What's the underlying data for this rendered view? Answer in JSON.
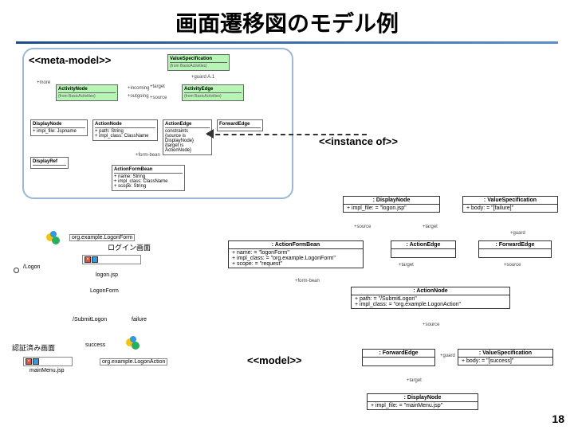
{
  "title": "画面遷移図のモデル例",
  "slide_number": "18",
  "labels": {
    "meta_model": "<<meta-model>>",
    "instance_of": "<<instance of>>",
    "model": "<<model>>"
  },
  "meta": {
    "value_spec": {
      "name": "ValueSpecification",
      "sub": "(from BasicActivities)"
    },
    "activity_node": {
      "name": "ActivityNode",
      "sub": "(from BasicActivities)"
    },
    "activity_edge": {
      "name": "ActivityEdge",
      "sub": "(from BasicActivities)"
    },
    "display_node": {
      "name": "DisplayNode",
      "attr": "+ impl_file: Jspname"
    },
    "action_node": {
      "name": "ActionNode",
      "attr": "+ path: String\n+ impl_class: ClassName"
    },
    "forward_edge": {
      "name": "ForwardEdge"
    },
    "action_edge": {
      "name": "ActionEdge",
      "constraint": "constraints\n{source is DisplayNode}\n{target is ActionNode}"
    },
    "action_form_bean": {
      "name": "ActionFormBean",
      "attr": "+ name: String\n+ impl_class: ClassName\n+ scope: String"
    },
    "display_ref": {
      "name": "DisplayRef"
    },
    "more": "+more"
  },
  "model_diagram": {
    "login_title": "ログイン画面",
    "auth_title": "認証済み画面",
    "logon": "/Logon",
    "logon_jsp": "logon.jsp",
    "logon_form": "LogonForm",
    "submit_logon": "/SubmitLogon",
    "main_menu": "mainMenu.jsp",
    "failure": "failure",
    "success": "success",
    "logon_form_pkg": "org.example.LogonForm",
    "logon_action_pkg": "org.example.LogonAction"
  },
  "uml": {
    "display_node": {
      "title": ": DisplayNode",
      "r1": "+ impl_file: = \"logon.jsp\""
    },
    "value_spec1": {
      "title": ": ValueSpecification",
      "r1": "+ body: = \"[failure]\""
    },
    "action_form_bean": {
      "title": ": ActionFormBean",
      "r1": "+ name: = \"logonForm\"",
      "r2": "+ impl_class: = \"org.example.LogonForm\"",
      "r3": "+ scope: = \"request\""
    },
    "action_edge": {
      "title": ": ActionEdge"
    },
    "forward_edge1": {
      "title": ": ForwardEdge"
    },
    "action_node": {
      "title": ": ActionNode",
      "r1": "+ path: = \"/SubmitLogon\"",
      "r2": "+ impl_class: = \"org.example.LogonAction\""
    },
    "forward_edge2": {
      "title": ": ForwardEdge"
    },
    "value_spec2": {
      "title": ": ValueSpecification",
      "r1": "+ body: = \"[success]\""
    },
    "display_node2": {
      "title": ": DisplayNode",
      "r1": "+ impl_file: = \"mainMenu.jsp\""
    }
  },
  "edges": {
    "source": "+source",
    "target": "+target",
    "form_bean": "+form-bean",
    "guard": "+guard",
    "incoming": "+incoming",
    "outgoing": "+outgoing",
    "a1": "+guard A.1"
  }
}
